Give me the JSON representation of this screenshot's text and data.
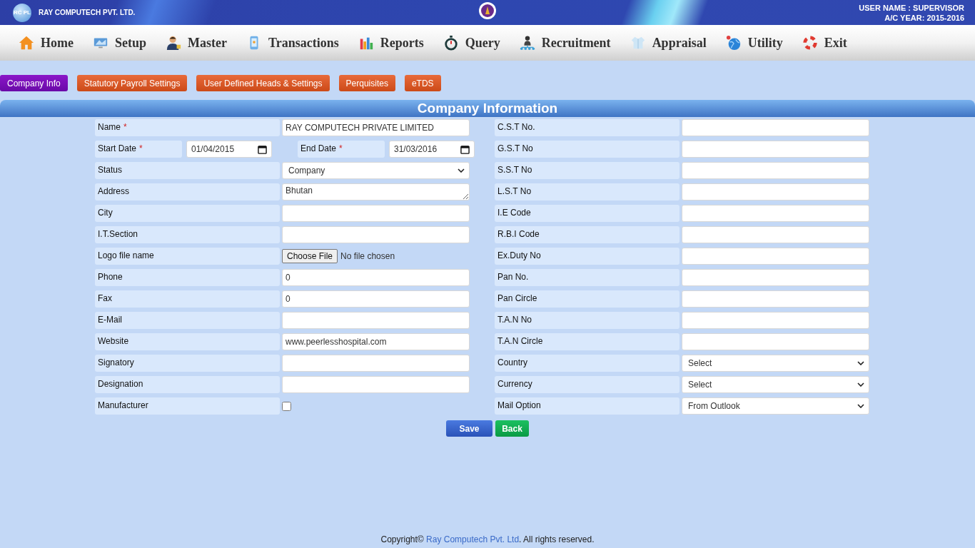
{
  "header": {
    "logo": "RC PL",
    "company": "RAY COMPUTECH PVT. LTD.",
    "user_name": "USER NAME : SUPERVISOR",
    "ac_year": "A/C YEAR: 2015-2016"
  },
  "nav": [
    {
      "label": "Home"
    },
    {
      "label": "Setup"
    },
    {
      "label": "Master"
    },
    {
      "label": "Transactions"
    },
    {
      "label": "Reports"
    },
    {
      "label": "Query"
    },
    {
      "label": "Recruitment"
    },
    {
      "label": "Appraisal"
    },
    {
      "label": "Utility"
    },
    {
      "label": "Exit"
    }
  ],
  "tabs": [
    {
      "label": "Company Info",
      "selected": true
    },
    {
      "label": "Statutory Payroll Settings",
      "selected": false
    },
    {
      "label": "User Defined Heads & Settings",
      "selected": false
    },
    {
      "label": "Perquisites",
      "selected": false
    },
    {
      "label": "eTDS",
      "selected": false
    }
  ],
  "section_title": "Company Information",
  "left_fields": [
    {
      "kind": "text",
      "label": "Name",
      "mark": "*",
      "value": "RAY COMPUTECH PRIVATE LIMITED"
    },
    {
      "kind": "date_pair",
      "fields": [
        {
          "label": "Start Date",
          "mark": "*",
          "value": "01/04/2015"
        },
        {
          "label": "End Date",
          "mark": "*",
          "value": "31/03/2016"
        }
      ]
    },
    {
      "kind": "select",
      "label": "Status",
      "value": "Company"
    },
    {
      "kind": "textarea",
      "label": "Address",
      "value": "Bhutan"
    },
    {
      "kind": "text",
      "label": "City"
    },
    {
      "kind": "text",
      "label": "I.T.Section"
    },
    {
      "kind": "file",
      "label": "Logo file name",
      "button": "Choose File",
      "value": "No file chosen"
    },
    {
      "kind": "text",
      "label": "Phone",
      "value": "0"
    },
    {
      "kind": "text",
      "label": "Fax",
      "value": "0"
    },
    {
      "kind": "text",
      "label": "E-Mail"
    },
    {
      "kind": "text",
      "label": "Website",
      "value": "www.peerlesshospital.com"
    },
    {
      "kind": "text",
      "label": "Signatory"
    },
    {
      "kind": "text",
      "label": "Designation"
    },
    {
      "kind": "checkbox",
      "label": "Manufacturer",
      "checked": false
    }
  ],
  "right_fields": [
    {
      "kind": "text",
      "label": "C.S.T No."
    },
    {
      "kind": "text",
      "label": "G.S.T No"
    },
    {
      "kind": "text",
      "label": "S.S.T No"
    },
    {
      "kind": "text",
      "label": "L.S.T No"
    },
    {
      "kind": "text",
      "label": "I.E Code"
    },
    {
      "kind": "text",
      "label": "R.B.I Code"
    },
    {
      "kind": "text",
      "label": "Ex.Duty No"
    },
    {
      "kind": "text",
      "label": "Pan No."
    },
    {
      "kind": "text",
      "label": "Pan Circle"
    },
    {
      "kind": "text",
      "label": "T.A.N No"
    },
    {
      "kind": "text",
      "label": "T.A.N Circle"
    },
    {
      "kind": "select",
      "label": "Country",
      "value": "Select"
    },
    {
      "kind": "select",
      "label": "Currency",
      "value": "Select"
    },
    {
      "kind": "select",
      "label": "Mail Option",
      "value": "From Outlook"
    }
  ],
  "buttons": [
    {
      "label": "Save",
      "kind": "primary"
    },
    {
      "label": "Back",
      "kind": "secondary"
    }
  ],
  "footer": {
    "prefix": "Copyright© ",
    "link": "Ray Computech Pvt. Ltd",
    "suffix": ". All rights reserved."
  }
}
